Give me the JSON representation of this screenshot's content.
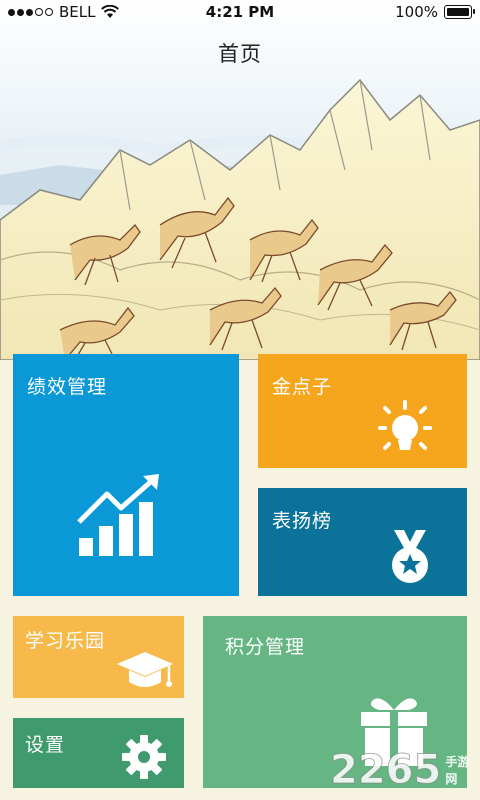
{
  "status_bar": {
    "carrier": "BELL",
    "time": "4:21 PM",
    "battery": "100%",
    "signal_bars_filled": 3,
    "signal_bars_total": 5
  },
  "nav": {
    "title": "首页"
  },
  "tiles": {
    "performance": {
      "label": "绩效管理",
      "icon": "growth-chart-icon",
      "color": "#0a98d6"
    },
    "ideas": {
      "label": "金点子",
      "icon": "lightbulb-icon",
      "color": "#f6a61c"
    },
    "praise": {
      "label": "表扬榜",
      "icon": "medal-icon",
      "color": "#0b7299"
    },
    "study": {
      "label": "学习乐园",
      "icon": "graduation-cap-icon",
      "color": "#f7b94a"
    },
    "settings": {
      "label": "设置",
      "icon": "gear-icon",
      "color": "#3f9a6e"
    },
    "points": {
      "label": "积分管理",
      "icon": "gift-icon",
      "color": "#66b684"
    }
  },
  "watermark": {
    "number": "2265",
    "site": "手游网"
  }
}
